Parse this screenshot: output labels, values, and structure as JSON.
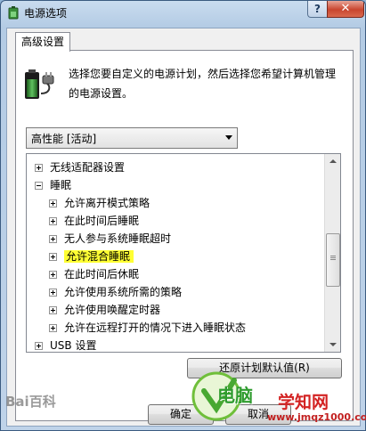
{
  "window": {
    "title": "电源选项",
    "help_label": "?",
    "close_label": "✕"
  },
  "tabs": [
    {
      "label": "高级设置"
    }
  ],
  "description": {
    "line1": "选择您要自定义的电源计划，然后选择您希望计算机管理",
    "line2": "的电源设置。"
  },
  "plan_select": {
    "value": "高性能 [活动]"
  },
  "tree": {
    "items": [
      {
        "label": "无线适配器设置",
        "expander": "plus",
        "level": 0
      },
      {
        "label": "睡眠",
        "expander": "minus",
        "level": 0
      },
      {
        "label": "允许离开模式策略",
        "expander": "plus",
        "level": 1
      },
      {
        "label": "在此时间后睡眠",
        "expander": "plus",
        "level": 1
      },
      {
        "label": "无人参与系统睡眠超时",
        "expander": "plus",
        "level": 1
      },
      {
        "label": "允许混合睡眠",
        "expander": "plus",
        "level": 1,
        "highlighted": true
      },
      {
        "label": "在此时间后休眠",
        "expander": "plus",
        "level": 1
      },
      {
        "label": "允许使用系统所需的策略",
        "expander": "plus",
        "level": 1
      },
      {
        "label": "允许使用唤醒定时器",
        "expander": "plus",
        "level": 1
      },
      {
        "label": "允许在远程打开的情况下进入睡眠状态",
        "expander": "plus",
        "level": 1
      },
      {
        "label": "USB 设置",
        "expander": "plus",
        "level": 0
      }
    ],
    "highlight_color": "#ffff33"
  },
  "buttons": {
    "restore_defaults": "还原计划默认值(R)",
    "ok": "确定",
    "cancel": "取消"
  },
  "watermarks": {
    "baidu": "Bai百科",
    "site_name": "学知网",
    "site_url": "www.jmqz1000.com",
    "brand": "电脑"
  }
}
